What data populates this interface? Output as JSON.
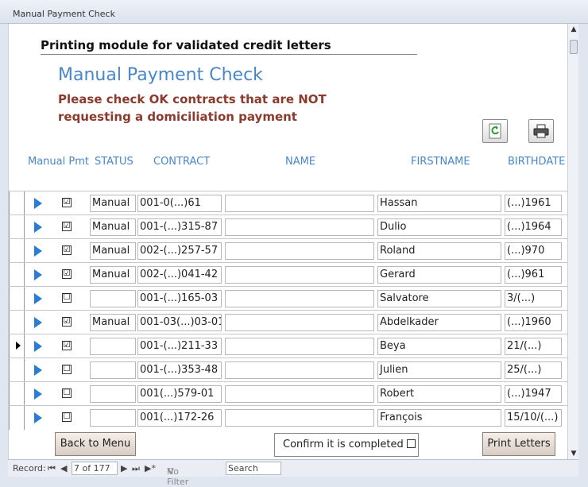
{
  "window": {
    "title": "Manual Payment Check"
  },
  "form": {
    "module_title": "Printing module for validated credit letters",
    "title": "Manual Payment Check",
    "subtitle_line1": "Please check OK contracts that are NOT",
    "subtitle_line2": "requesting a domiciliation payment"
  },
  "toolbar": {
    "refresh_icon": "refresh-icon",
    "print_icon": "printer-icon"
  },
  "columns": {
    "manual_pmt": "Manual Pmt",
    "status": "STATUS",
    "contract": "CONTRACT",
    "name": "NAME",
    "firstname": "FIRSTNAME",
    "birthdate": "BIRTHDATE"
  },
  "rows": [
    {
      "checked": "☑",
      "status": "Manual",
      "contract": "001-0(...)61",
      "name": "",
      "firstname": "Hassan",
      "birthdate": "(...)1961"
    },
    {
      "checked": "☑",
      "status": "Manual",
      "contract": "001-(...)315-87",
      "name": "",
      "firstname": "Dulio",
      "birthdate": "(...)1964"
    },
    {
      "checked": "☑",
      "status": "Manual",
      "contract": "002-(...)257-57",
      "name": "",
      "firstname": "Roland",
      "birthdate": "(...)970"
    },
    {
      "checked": "☑",
      "status": "Manual",
      "contract": "002-(...)041-42",
      "name": "",
      "firstname": "Gerard",
      "birthdate": "(...)961"
    },
    {
      "checked": "☐",
      "status": "",
      "contract": "001-(...)165-03",
      "name": "",
      "firstname": "Salvatore",
      "birthdate": "3/(...)"
    },
    {
      "checked": "☑",
      "status": "Manual",
      "contract": "001-03(...)03-01",
      "name": "",
      "firstname": "Abdelkader",
      "birthdate": "(...)1960"
    },
    {
      "checked": "☑",
      "status": "",
      "contract": "001-(...)211-33",
      "name": "",
      "firstname": "Beya",
      "birthdate": "21/(...)"
    },
    {
      "checked": "☐",
      "status": "",
      "contract": "001-(...)353-48",
      "name": "",
      "firstname": "Julien",
      "birthdate": "25/(...)"
    },
    {
      "checked": "☐",
      "status": "",
      "contract": "001(...)579-01",
      "name": "",
      "firstname": "Robert",
      "birthdate": "(...)1947"
    },
    {
      "checked": "☐",
      "status": "",
      "contract": "001(...)172-26",
      "name": "",
      "firstname": "François",
      "birthdate": "15/10/(...)"
    }
  ],
  "buttons": {
    "back": "Back to Menu",
    "confirm": "Confirm it is completed",
    "print": "Print Letters"
  },
  "navigation": {
    "record_label": "Record:",
    "record_value": "7 of 177",
    "filter_label": "No Filter",
    "search_label": "Search"
  }
}
